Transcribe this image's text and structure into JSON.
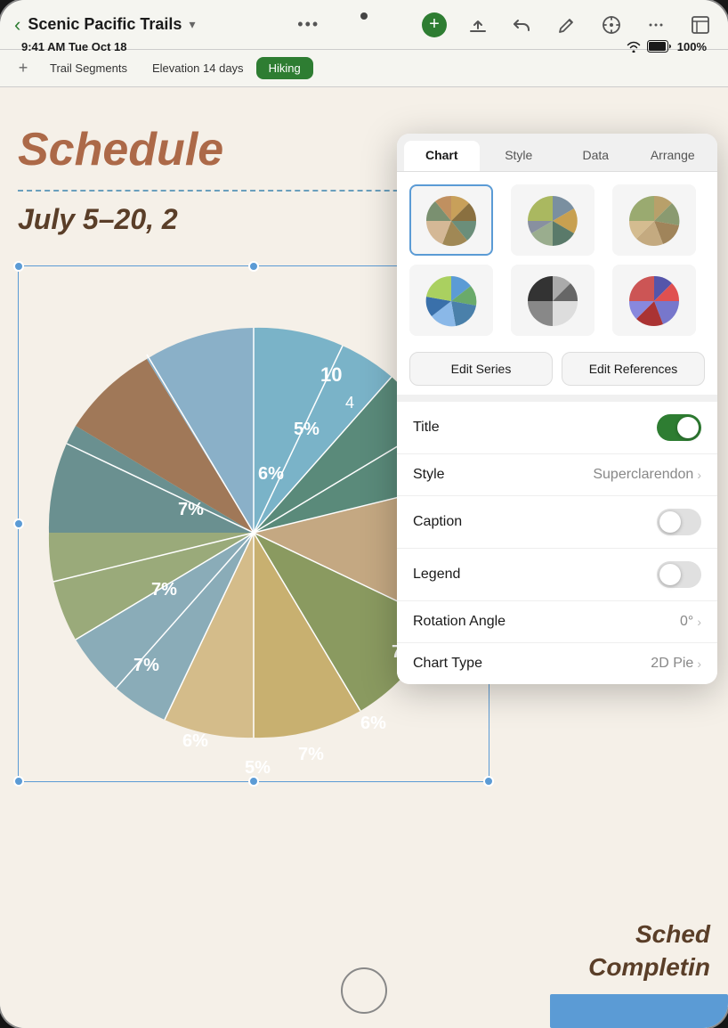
{
  "device": {
    "camera_dot": "•",
    "home_button": ""
  },
  "status_bar": {
    "time": "9:41 AM",
    "date": "Tue Oct 18",
    "battery": "100%"
  },
  "titlebar": {
    "back_label": "‹",
    "doc_title": "Scenic Pacific Trails",
    "chevron": "▾",
    "more_dots": "• • •",
    "add_label": "+"
  },
  "toolbar_icons": {
    "upload": "upload",
    "undo": "undo",
    "pen": "pen",
    "format": "format",
    "more": "more",
    "sheets": "sheets"
  },
  "tabs": {
    "add_label": "+",
    "items": [
      {
        "label": "Trail Segments",
        "active": false
      },
      {
        "label": "Elevation 14 days",
        "active": false
      },
      {
        "label": "Hiking",
        "active": true
      }
    ]
  },
  "doc": {
    "schedule_title": "Schedule",
    "date_subtitle": "July 5–20, 2",
    "sched_complete_line1": "Sched",
    "sched_complete_line2": "Completin"
  },
  "chart_panel": {
    "tabs": [
      {
        "label": "Chart",
        "active": true
      },
      {
        "label": "Style",
        "active": false
      },
      {
        "label": "Data",
        "active": false
      },
      {
        "label": "Arrange",
        "active": false
      }
    ],
    "thumbnails": [
      {
        "id": "thumb1",
        "colors": [
          "#c8a05a",
          "#6b8e7a",
          "#8b7355",
          "#d4b896"
        ]
      },
      {
        "id": "thumb2",
        "colors": [
          "#7a8fa0",
          "#c8a050",
          "#5a7a6a",
          "#9aad8e"
        ]
      },
      {
        "id": "thumb3",
        "colors": [
          "#b8a06a",
          "#8a9a70",
          "#a0845a",
          "#c4aa80"
        ]
      },
      {
        "id": "thumb4",
        "colors": [
          "#5b9bd5",
          "#6aaa6a",
          "#4a80aa",
          "#8ab8e8"
        ]
      },
      {
        "id": "thumb5",
        "colors": [
          "#888",
          "#555",
          "#aaa",
          "#333"
        ]
      },
      {
        "id": "thumb6",
        "colors": [
          "#5555aa",
          "#e05050",
          "#7777cc",
          "#aa3333"
        ]
      }
    ],
    "selected_thumb": 0,
    "edit_series_label": "Edit Series",
    "edit_references_label": "Edit References",
    "settings": [
      {
        "id": "title",
        "label": "Title",
        "type": "toggle",
        "value": true
      },
      {
        "id": "style",
        "label": "Style",
        "type": "value",
        "value": "Superclarendon"
      },
      {
        "id": "caption",
        "label": "Caption",
        "type": "toggle",
        "value": false
      },
      {
        "id": "legend",
        "label": "Legend",
        "type": "toggle",
        "value": false
      },
      {
        "id": "rotation_angle",
        "label": "Rotation Angle",
        "type": "value",
        "value": "0°"
      },
      {
        "id": "chart_type",
        "label": "Chart Type",
        "type": "value",
        "value": "2D Pie"
      }
    ]
  }
}
